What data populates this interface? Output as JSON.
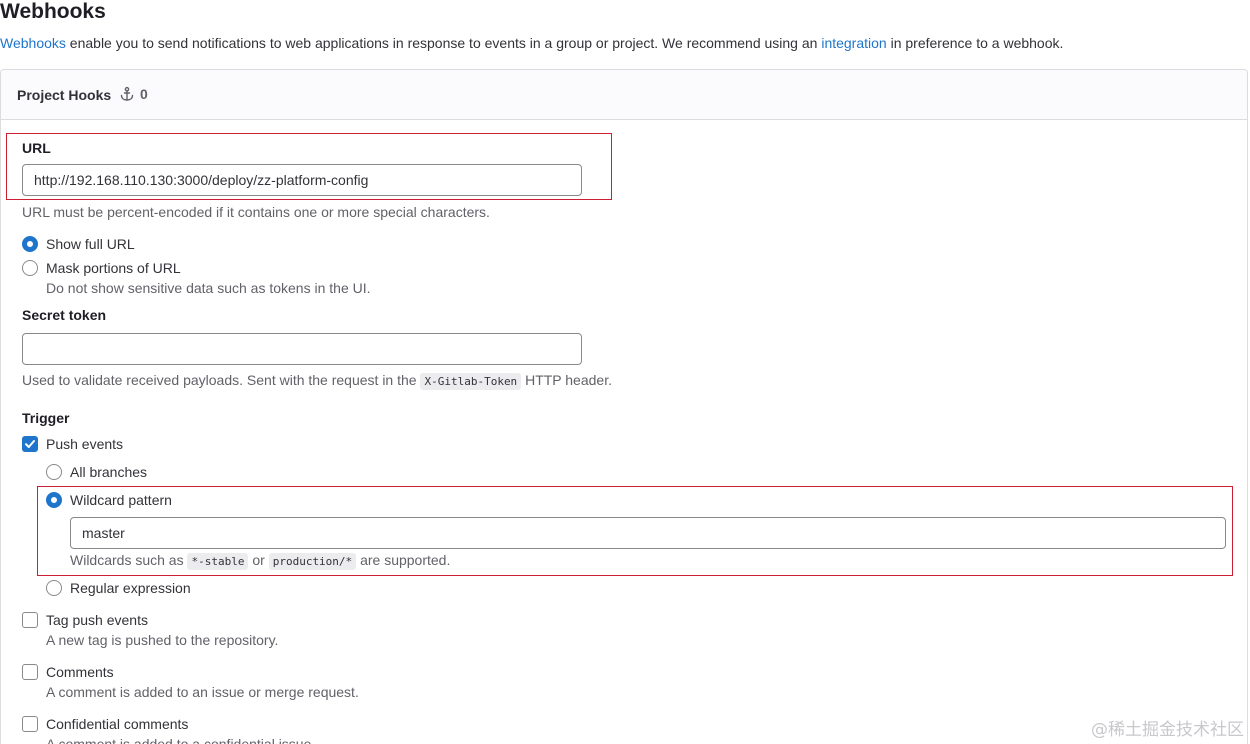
{
  "page": {
    "title": "Webhooks",
    "intro": {
      "link_webhooks": "Webhooks",
      "text_middle": " enable you to send notifications to web applications in response to events in a group or project. We recommend using an ",
      "link_integration": "integration",
      "text_end": " in preference to a webhook."
    }
  },
  "hooks_card": {
    "title": "Project Hooks",
    "count_icon": "anchor-icon",
    "count": "0"
  },
  "url_field": {
    "label": "URL",
    "value": "http://192.168.110.130:3000/deploy/zz-platform-config",
    "help": "URL must be percent-encoded if it contains one or more special characters."
  },
  "url_display": {
    "show_full": {
      "label": "Show full URL",
      "checked": true
    },
    "mask": {
      "label": "Mask portions of URL",
      "checked": false,
      "help": "Do not show sensitive data such as tokens in the UI."
    }
  },
  "secret_token": {
    "label": "Secret token",
    "value": "",
    "help_before": "Used to validate received payloads. Sent with the request in the ",
    "help_code": "X-Gitlab-Token",
    "help_after": " HTTP header."
  },
  "trigger": {
    "label": "Trigger",
    "push_events": {
      "label": "Push events",
      "checked": true,
      "all_branches": {
        "label": "All branches",
        "checked": false
      },
      "wildcard": {
        "label": "Wildcard pattern",
        "checked": true,
        "value": "master",
        "help_before": "Wildcards such as ",
        "code1": "*-stable",
        "help_or": " or ",
        "code2": "production/*",
        "help_after": " are supported."
      },
      "regex": {
        "label": "Regular expression",
        "checked": false
      }
    },
    "tag_push": {
      "label": "Tag push events",
      "checked": false,
      "help": "A new tag is pushed to the repository."
    },
    "comments": {
      "label": "Comments",
      "checked": false,
      "help": "A comment is added to an issue or merge request."
    },
    "confidential_comments": {
      "label": "Confidential comments",
      "checked": false,
      "help": "A comment is added to a confidential issue."
    }
  },
  "watermark": "@稀土掘金技术社区",
  "colors": {
    "accent": "#1f75cb",
    "highlight_border": "#cc1f34",
    "border": "#dcdcde"
  }
}
